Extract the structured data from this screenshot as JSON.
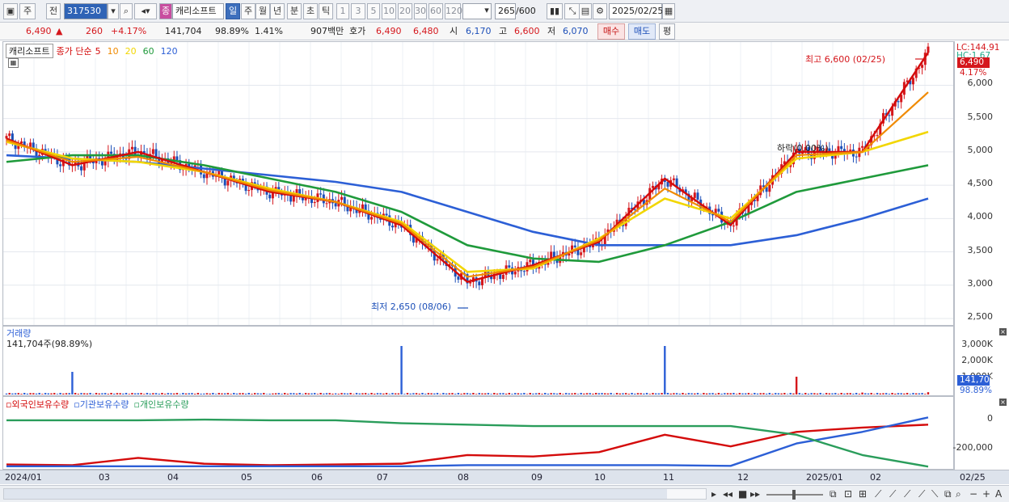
{
  "toolbar": {
    "market": "주",
    "view": "전",
    "code": "317530",
    "product_badge": "종",
    "name": "캐리소프트",
    "periods": [
      "일",
      "주",
      "월",
      "년",
      "분",
      "초",
      "틱"
    ],
    "active_period": "일",
    "intervals": [
      "1",
      "3",
      "5",
      "10",
      "20",
      "30",
      "60",
      "120"
    ],
    "count": "265",
    "count_max": "/600",
    "date": "2025/02/25"
  },
  "quote": {
    "price": "6,490",
    "change": "260",
    "change_pct": "+4.17%",
    "volume": "141,704",
    "vol_ratio": "98.89%",
    "turnover": "1.41%",
    "amount": "907백만",
    "ask_label": "호가",
    "ask1": "6,490",
    "ask2": "6,480",
    "open_label": "시",
    "open": "6,170",
    "high_label": "고",
    "high": "6,600",
    "low_label": "저",
    "low": "6,070",
    "buy": "매수",
    "sell": "매도",
    "eval": "평"
  },
  "price_panel": {
    "stock_label": "캐리소프트",
    "ma_title": "종가 단순",
    "ma_periods": [
      {
        "label": "5",
        "color": "#d40b0b"
      },
      {
        "label": "10",
        "color": "#f08a00"
      },
      {
        "label": "20",
        "color": "#f2d600"
      },
      {
        "label": "60",
        "color": "#1f9a3b"
      },
      {
        "label": "120",
        "color": "#2c5fd6"
      }
    ],
    "max_note": "최고 6,600 (02/25)",
    "min_note": "최저 2,650 (08/06)",
    "mid_note": "하락(0.00%)",
    "lc": "LC:144.91",
    "hc": "HC:1.67",
    "current_tag": "6,490",
    "current_pct": "4.17%",
    "y_ticks": [
      "6,000",
      "5,500",
      "5,000",
      "4,500",
      "4,000",
      "3,500",
      "3,000",
      "2,500"
    ]
  },
  "volume_panel": {
    "title": "거래량",
    "readout": "141,704주(98.89%)",
    "y_ticks": [
      "3,000K",
      "2,000K",
      "1,000K"
    ],
    "current_tag": "141,704",
    "current_pct": "98.89%"
  },
  "holdings_panel": {
    "series": [
      {
        "label": "외국인보유수량",
        "color": "#d40b0b"
      },
      {
        "label": "기관보유수량",
        "color": "#2c5fd6"
      },
      {
        "label": "개인보유수량",
        "color": "#2a9d5b"
      }
    ],
    "y_ticks": [
      "0",
      "-200,000"
    ]
  },
  "x_axis": {
    "labels": [
      "2024/01",
      "03",
      "04",
      "05",
      "06",
      "07",
      "08",
      "09",
      "10",
      "11",
      "12",
      "2025/01",
      "02"
    ],
    "end_label": "02/25"
  },
  "colors": {
    "up": "#d5171c",
    "down": "#1c4fb8",
    "accent": "#2f63b6"
  },
  "chart_data": [
    {
      "type": "line",
      "title": "캐리소프트",
      "x": [
        "2024/01",
        "02",
        "03",
        "04",
        "05",
        "06",
        "07",
        "08",
        "09",
        "10",
        "11",
        "12",
        "2025/01",
        "02",
        "02/25"
      ],
      "series": [
        {
          "name": "5",
          "values": [
            5200,
            4800,
            5000,
            4700,
            4400,
            4250,
            3900,
            3050,
            3300,
            3650,
            4600,
            3900,
            5000,
            5000,
            6490
          ]
        },
        {
          "name": "20",
          "values": [
            5150,
            4900,
            4850,
            4700,
            4450,
            4250,
            3950,
            3200,
            3250,
            3700,
            4300,
            4000,
            4900,
            5000,
            5300
          ]
        },
        {
          "name": "60",
          "values": [
            4850,
            4950,
            4950,
            4800,
            4600,
            4400,
            4100,
            3600,
            3400,
            3350,
            3600,
            3950,
            4400,
            4600,
            4800
          ]
        },
        {
          "name": "120",
          "values": [
            4950,
            4900,
            4850,
            4750,
            4650,
            4550,
            4400,
            4100,
            3800,
            3600,
            3600,
            3600,
            3750,
            4000,
            4300
          ]
        }
      ],
      "ylim": [
        2500,
        6600
      ]
    },
    {
      "type": "bar",
      "title": "거래량",
      "x": [
        "2024/01",
        "02",
        "03",
        "04",
        "05",
        "06",
        "07",
        "08",
        "09",
        "10",
        "11",
        "12",
        "2025/01",
        "02",
        "02/25"
      ],
      "values": [
        60,
        1400,
        80,
        60,
        50,
        70,
        3000,
        90,
        60,
        80,
        3000,
        80,
        1100,
        120,
        141.704
      ],
      "ylim": [
        0,
        3500
      ]
    },
    {
      "type": "line",
      "x": [
        "2024/01",
        "02",
        "03",
        "04",
        "05",
        "06",
        "07",
        "08",
        "09",
        "10",
        "11",
        "12",
        "2025/01",
        "02",
        "02/25"
      ],
      "series": [
        {
          "name": "외국인보유수량",
          "values": [
            -305000,
            -310000,
            -260000,
            -300000,
            -310000,
            -305000,
            -300000,
            -240000,
            -250000,
            -220000,
            -100000,
            -180000,
            -80000,
            -50000,
            -30000
          ]
        },
        {
          "name": "기관보유수량",
          "values": [
            -318000,
            -318000,
            -318000,
            -318000,
            -318000,
            -318000,
            -318000,
            -310000,
            -310000,
            -310000,
            -310000,
            -315000,
            -160000,
            -80000,
            20000
          ]
        },
        {
          "name": "개인보유수량",
          "values": [
            0,
            0,
            0,
            5000,
            0,
            0,
            -20000,
            -30000,
            -40000,
            -40000,
            -40000,
            -40000,
            -100000,
            -240000,
            -320000
          ]
        }
      ],
      "ylim": [
        -330000,
        50000
      ]
    }
  ]
}
